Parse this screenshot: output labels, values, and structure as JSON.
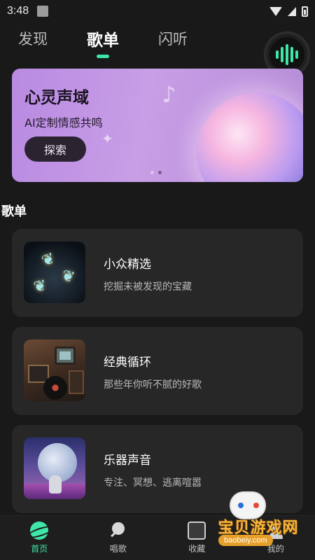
{
  "status_bar": {
    "time": "3:48"
  },
  "top_tabs": [
    {
      "label": "发现",
      "active": false
    },
    {
      "label": "歌单",
      "active": true
    },
    {
      "label": "闪听",
      "active": false
    }
  ],
  "voice_button": {
    "icon": "soundwave-icon",
    "accent": "#3ee6a8"
  },
  "banner": {
    "title": "心灵声域",
    "subtitle": "AI定制情感共鸣",
    "button_label": "探索",
    "page_count": 2,
    "active_page": 2
  },
  "section": {
    "title": "歌单"
  },
  "playlists": [
    {
      "title": "小众精选",
      "description": "挖掘未被发现的宝藏"
    },
    {
      "title": "经典循环",
      "description": "那些年你听不腻的好歌"
    },
    {
      "title": "乐器声音",
      "description": "专注、冥想、逃离喧嚣"
    }
  ],
  "bottom_nav": [
    {
      "label": "首页",
      "icon": "planet-icon",
      "active": true
    },
    {
      "label": "唱歌",
      "icon": "microphone-icon",
      "active": false
    },
    {
      "label": "收藏",
      "icon": "favorites-icon",
      "active": false
    },
    {
      "label": "我的",
      "icon": "profile-icon",
      "active": false
    }
  ],
  "watermark": {
    "text": "宝贝游戏网",
    "domain": "baobeiy.com"
  },
  "colors": {
    "accent": "#3ee6a8",
    "background": "#191919",
    "card": "#272727",
    "banner": "#c89ee6"
  }
}
